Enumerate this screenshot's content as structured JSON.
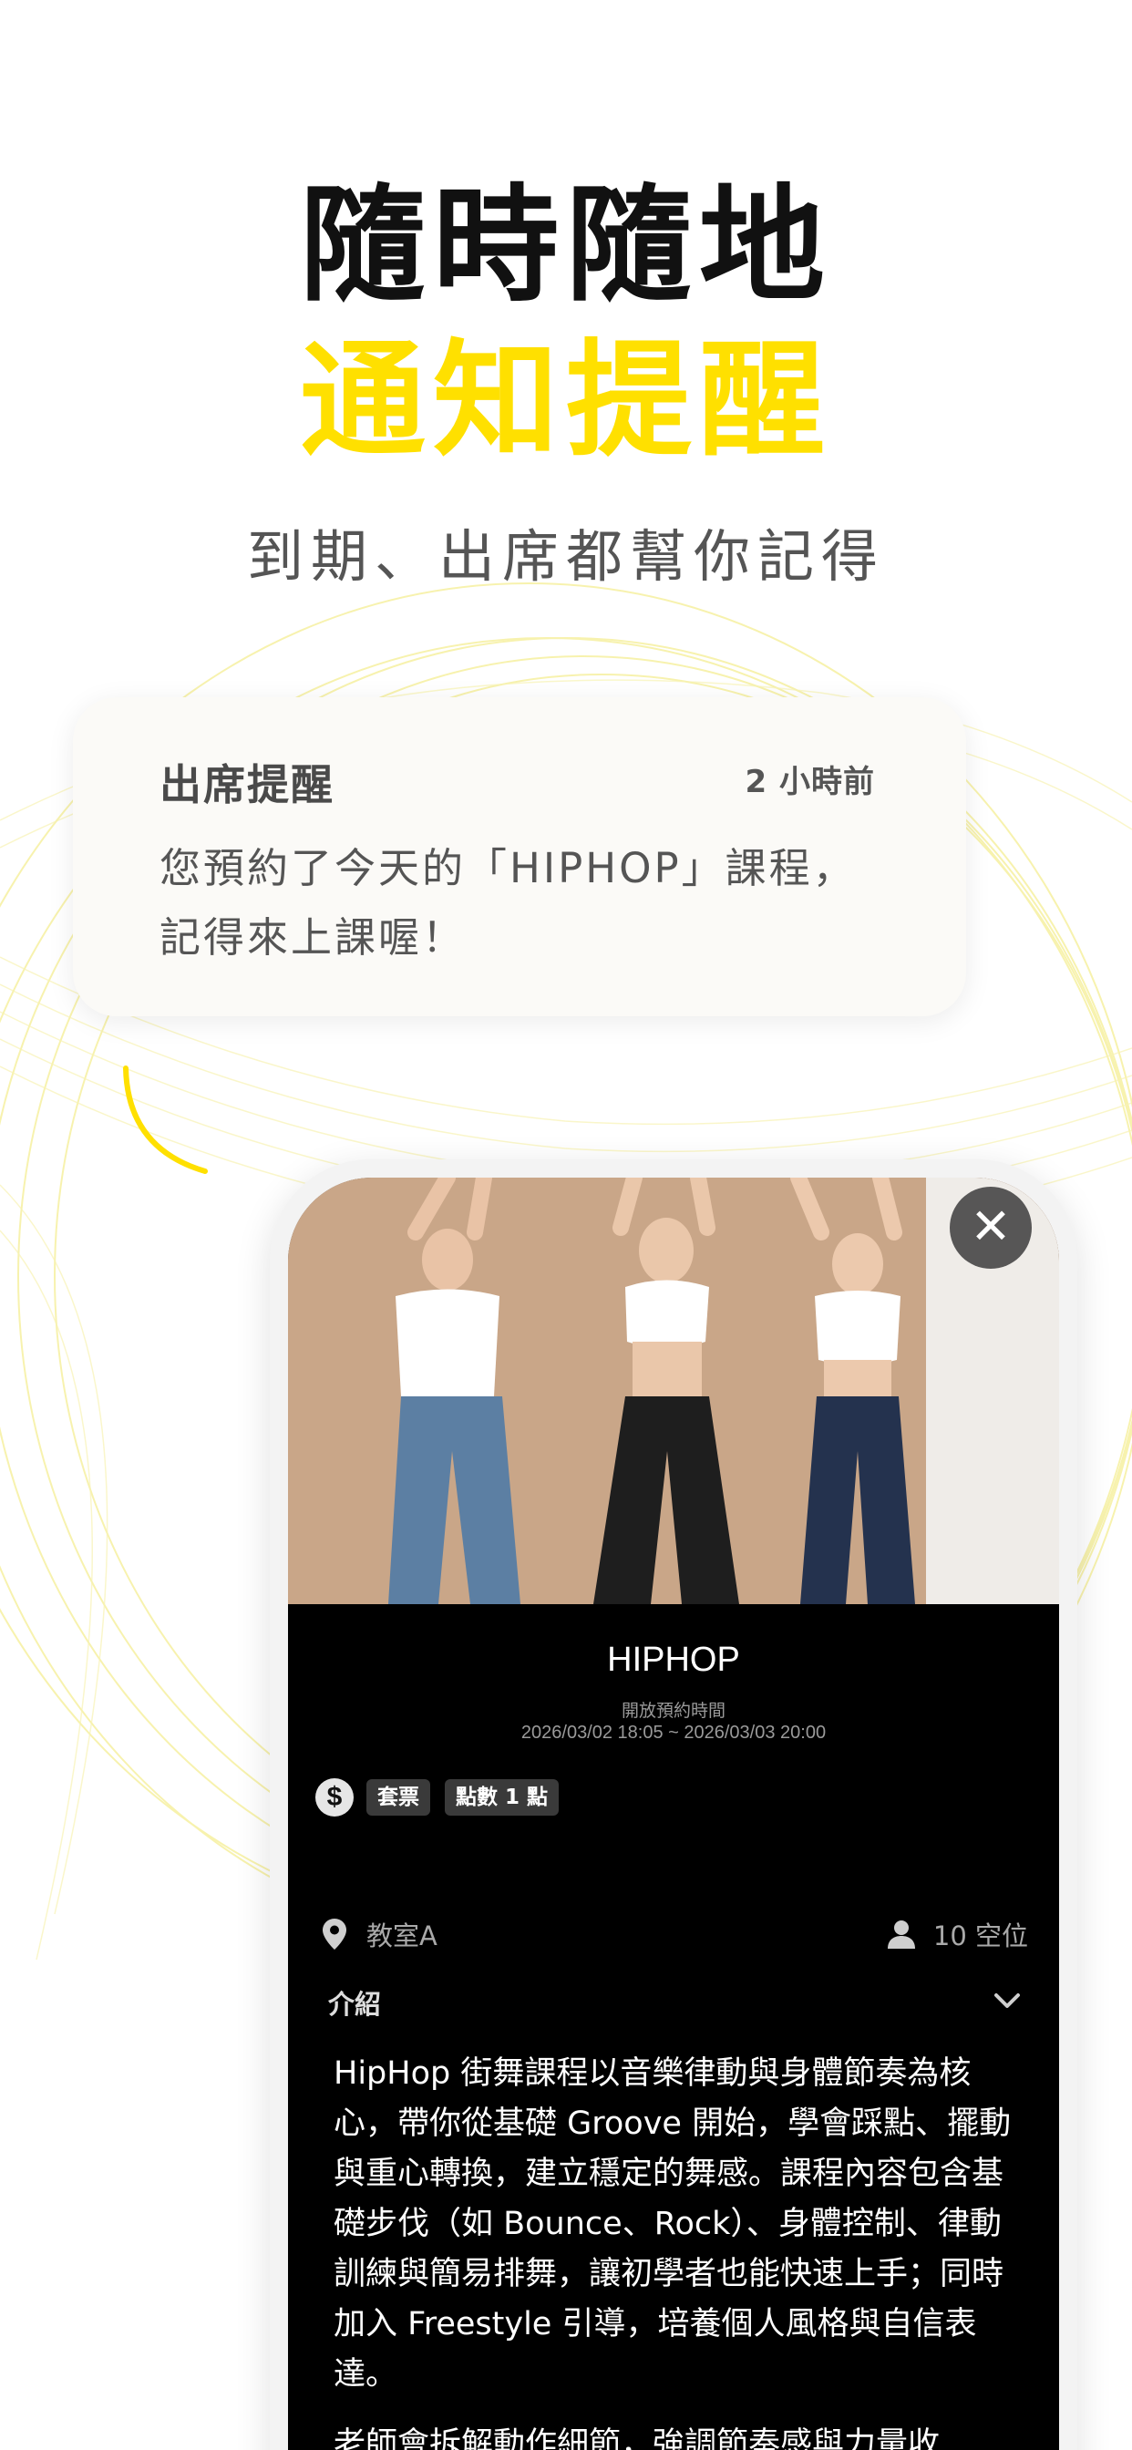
{
  "headline": {
    "line1": "隨時隨地",
    "line2": "通知提醒",
    "subtitle": "到期、出席都幫你記得"
  },
  "notification": {
    "title": "出席提醒",
    "time": "2 小時前",
    "body_line1": "您預約了今天的「HIPHOP」課程，",
    "body_line2": "記得來上課喔！"
  },
  "course": {
    "title": "HIPHOP",
    "open_label": "開放預約時間",
    "open_range": "2026/03/02 18:05 ~ 2026/03/03 20:00",
    "tags": [
      "套票",
      "點數 1 點"
    ],
    "location": "教室A",
    "seats": "10 空位",
    "intro_label": "介紹",
    "intro_paragraphs": [
      "HipHop 街舞課程以音樂律動與身體節奏為核心，帶你從基礎 Groove 開始，學會踩點、擺動與重心轉換，建立穩定的舞感。課程內容包含基礎步伐（如 Bounce、Rock）、身體控制、律動訓練與簡易排舞，讓初學者也能快速上手；同時加入 Freestyle 引導，培養個人風格與自信表達。",
      "老師會拆解動作細節，強調節奏感與力量收"
    ]
  },
  "colors": {
    "accent_yellow": "#ffe000",
    "headline_black": "#111111",
    "detail_background": "#000000"
  },
  "icons": [
    "close-icon",
    "location-pin-icon",
    "person-icon",
    "chevron-down-icon",
    "coin-icon"
  ]
}
